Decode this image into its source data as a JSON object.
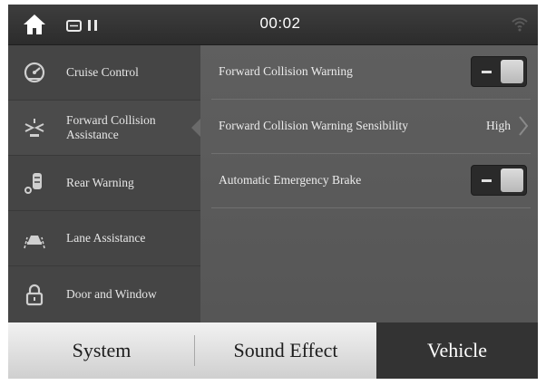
{
  "status_bar": {
    "time": "00:02",
    "icons": [
      "home-icon",
      "media-icon",
      "wifi-icon"
    ]
  },
  "sidebar": {
    "items": [
      {
        "label": "Cruise Control",
        "icon": "cruise-control-icon",
        "active": false
      },
      {
        "label": "Forward Collision Assistance",
        "icon": "forward-collision-icon",
        "active": true
      },
      {
        "label": "Rear Warning",
        "icon": "rear-warning-icon",
        "active": false
      },
      {
        "label": "Lane Assistance",
        "icon": "lane-assistance-icon",
        "active": false
      },
      {
        "label": "Door and Window",
        "icon": "door-lock-icon",
        "active": false
      }
    ]
  },
  "settings": {
    "forward_collision_warning": {
      "label": "Forward Collision Warning",
      "state": "on"
    },
    "warning_sensibility": {
      "label": "Forward Collision Warning Sensibility",
      "value": "High"
    },
    "automatic_emergency_brake": {
      "label": "Automatic Emergency Brake",
      "state": "on"
    }
  },
  "tabs": [
    {
      "label": "System",
      "active": false
    },
    {
      "label": "Sound Effect",
      "active": false
    },
    {
      "label": "Vehicle",
      "active": true
    }
  ],
  "colors": {
    "active_tab_bg": "#333333",
    "inactive_tab_bg": "#e6e6e6",
    "panel_bg": "#5a5a5a",
    "sidebar_bg": "#454545"
  }
}
